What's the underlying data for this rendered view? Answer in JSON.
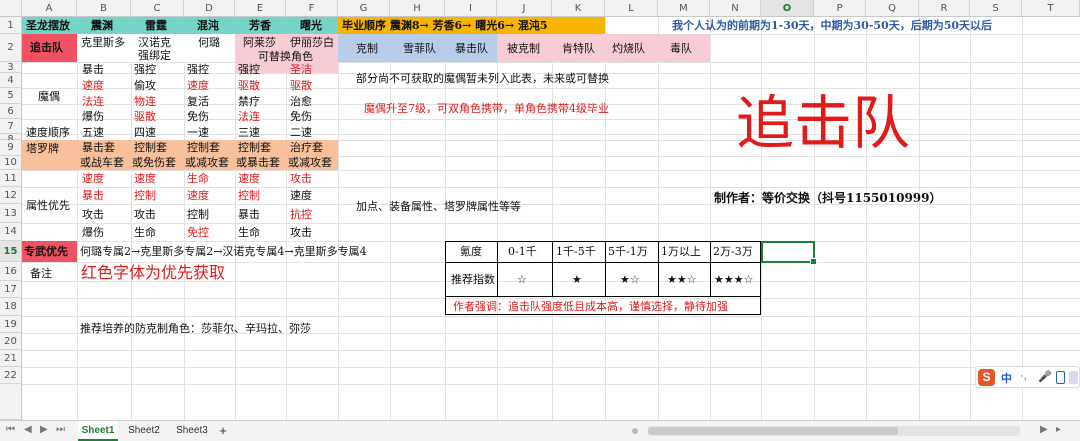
{
  "columns": [
    "A",
    "B",
    "C",
    "D",
    "E",
    "F",
    "G",
    "H",
    "I",
    "J",
    "K",
    "L",
    "M",
    "N",
    "O",
    "P",
    "Q",
    "R",
    "S",
    "T"
  ],
  "rows": [
    "1",
    "2",
    "3",
    "4",
    "5",
    "6",
    "7",
    "8",
    "9",
    "10",
    "11",
    "12",
    "13",
    "14",
    "15",
    "16",
    "17",
    "18",
    "19",
    "20",
    "21",
    "22"
  ],
  "header_row": {
    "a1": "圣龙摆放",
    "b1": "震渊",
    "c1": "雷霆",
    "d1": "混沌",
    "e1": "芳香",
    "f1": "曙光",
    "g1": "毕业顺序 震渊8→ 芳香6→ 曙光6→ 混沌5",
    "m1": "我个人认为的前期为1-30天，中期为30-50天，后期为50天以后"
  },
  "team": {
    "a2": "追击队",
    "b2": "克里斯多",
    "c2_1": "汉诺克",
    "c2_2": "强绑定",
    "d2": "何璐",
    "e2": "阿莱莎",
    "f2": "伊丽莎白",
    "ef3": "可替换角色"
  },
  "counter": {
    "g2": "克制",
    "h2": "雪菲队",
    "i2": "暴击队",
    "j2": "被克制",
    "k2": "肯特队",
    "l2": "灼烧队",
    "m2": "毒队"
  },
  "puppets": {
    "label": "魔偶",
    "b": [
      "暴击",
      "速度",
      "法连",
      "爆伤"
    ],
    "c": [
      "强控",
      "偷攻",
      "物连",
      "驱散"
    ],
    "d": [
      "强控",
      "速度",
      "复活",
      "免伤"
    ],
    "e": [
      "强控",
      "驱散",
      "禁疗",
      "法连"
    ],
    "f": [
      "圣洁",
      "驱散",
      "治愈",
      "免伤"
    ]
  },
  "puppet_note": "部分尚不可获取的魔偶暂未列入此表，未来或可替换",
  "puppet_note2": "魔偶升至7级，可双角色携带，单角色携带4级毕业",
  "speed": {
    "label": "速度顺序",
    "b": "五速",
    "c": "四速",
    "d": "一速",
    "e": "三速",
    "f": "二速"
  },
  "tarot": {
    "label": "塔罗牌",
    "b": [
      "暴击套",
      "或战车套"
    ],
    "c": [
      "控制套",
      "或免伤套"
    ],
    "d": [
      "控制套",
      "或减攻套"
    ],
    "e": [
      "控制套",
      "或暴击套"
    ],
    "f": [
      "治疗套",
      "或减攻套"
    ]
  },
  "attr": {
    "label": "属性优先",
    "b": [
      "速度",
      "暴击",
      "攻击",
      "爆伤"
    ],
    "c": [
      "速度",
      "控制",
      "攻击",
      "生命"
    ],
    "d": [
      "生命",
      "速度",
      "控制",
      "免控"
    ],
    "e": [
      "速度",
      "控制",
      "暴击",
      "生命"
    ],
    "f": [
      "攻击",
      "速度",
      "抗控",
      "攻击"
    ]
  },
  "attr_note": "加点、装备属性、塔罗牌属性等等",
  "big_title": "追击队",
  "author": "制作者：等价交换（抖号1155010999）",
  "exclusive": {
    "label": "专武优先",
    "text": "何璐专属2→克里斯多专属2→汉诺克专属4→克里斯多专属4"
  },
  "note": {
    "label": "备注",
    "text": "红色字体为优先获取"
  },
  "recommend": "推荐培养的防克制角色：莎菲尔、辛玛拉、弥莎",
  "rating": {
    "headers": [
      "氪度",
      "0-1千",
      "1千-5千",
      "5千-1万",
      "1万以上",
      "2万-3万"
    ],
    "row_label": "推荐指数",
    "stars": [
      "☆",
      "★",
      "★☆",
      "★★☆",
      "★★★☆"
    ],
    "warning": "作者强调：追击队强度低且成本高，谨慎选择，静待加强"
  },
  "tabs": [
    "Sheet1",
    "Sheet2",
    "Sheet3"
  ],
  "add_tab": "+",
  "ime": {
    "logo": "S",
    "lang": "中",
    "dot": "·,",
    "mic": "🎤"
  },
  "colors": {
    "green": "#74d5c6",
    "orange": "#f7b500",
    "pink": "#f8ccd4",
    "blue": "#b8cdea",
    "peach": "#f8c19c",
    "red": "#e21a1a",
    "header_pink": "#ef5363"
  }
}
